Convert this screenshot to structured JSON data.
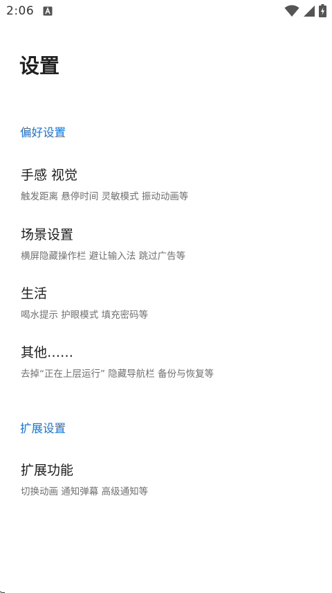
{
  "status_bar": {
    "time": "2:06",
    "notification_icon": "keyboard-a-icon",
    "wifi_icon": "wifi-icon",
    "signal_icon": "cell-signal-icon",
    "battery_icon": "battery-charging-icon"
  },
  "page": {
    "title": "设置"
  },
  "sections": [
    {
      "header": "偏好设置",
      "items": [
        {
          "title": "手感 视觉",
          "summary": "触发距离 悬停时间 灵敏模式 振动动画等"
        },
        {
          "title": "场景设置",
          "summary": "横屏隐藏操作栏 避让输入法 跳过广告等"
        },
        {
          "title": "生活",
          "summary": "喝水提示  护眼模式  填充密码等"
        },
        {
          "title": "其他……",
          "summary": "去掉“正在上层运行” 隐藏导航栏  备份与恢复等"
        }
      ]
    },
    {
      "header": "扩展设置",
      "items": [
        {
          "title": "扩展功能",
          "summary": "切换动画 通知弹幕 高级通知等"
        }
      ]
    }
  ],
  "colors": {
    "accent": "#1a73e8",
    "title_text": "#1c1c1c",
    "summary_text": "#707070",
    "background": "#ffffff"
  }
}
